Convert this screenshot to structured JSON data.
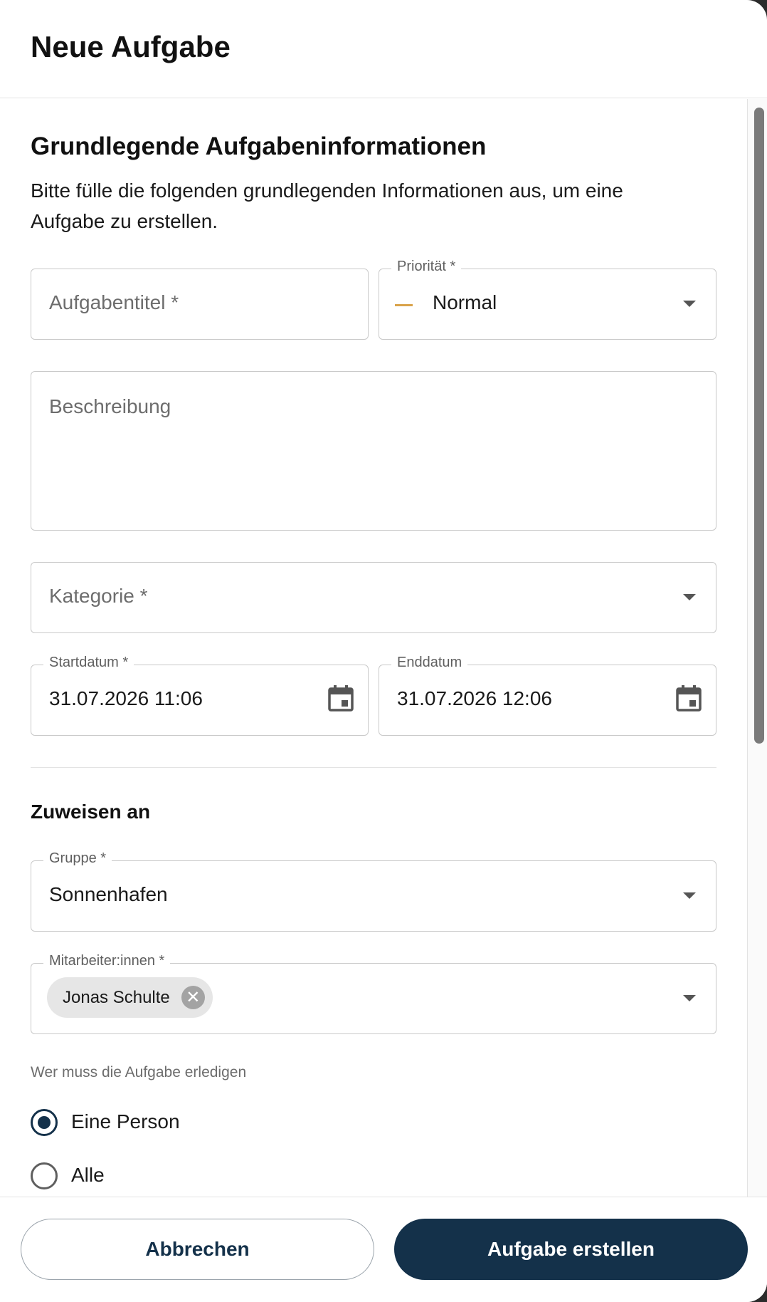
{
  "dialog": {
    "title": "Neue Aufgabe"
  },
  "basic_info": {
    "title": "Grundlegende Aufgabeninformationen",
    "description": "Bitte fülle die folgenden grundlegenden Informationen aus, um eine Aufgabe zu erstellen."
  },
  "fields": {
    "task_title": {
      "placeholder": "Aufgabentitel *",
      "value": ""
    },
    "priority": {
      "label": "Priorität *",
      "value": "Normal",
      "indicator_color": "#d9a34a"
    },
    "description": {
      "placeholder": "Beschreibung",
      "value": ""
    },
    "category": {
      "placeholder": "Kategorie *",
      "value": ""
    },
    "start_date": {
      "label": "Startdatum *",
      "value": "31.07.2026 11:06",
      "icon": "calendar-icon"
    },
    "end_date": {
      "label": "Enddatum",
      "value": "31.07.2026 12:06",
      "icon": "calendar-icon"
    }
  },
  "assign": {
    "title": "Zuweisen an",
    "group": {
      "label": "Gruppe *",
      "value": "Sonnenhafen"
    },
    "employees": {
      "label": "Mitarbeiter:innen *",
      "chips": [
        "Jonas Schulte"
      ]
    },
    "completion": {
      "label": "Wer muss die Aufgabe erledigen",
      "options": [
        {
          "label": "Eine Person",
          "checked": true
        },
        {
          "label": "Alle",
          "checked": false
        }
      ]
    }
  },
  "footer": {
    "cancel_label": "Abbrechen",
    "create_label": "Aufgabe erstellen"
  },
  "colors": {
    "primary": "#14314a",
    "border": "#c9c9c9",
    "priority_normal": "#d9a34a"
  }
}
